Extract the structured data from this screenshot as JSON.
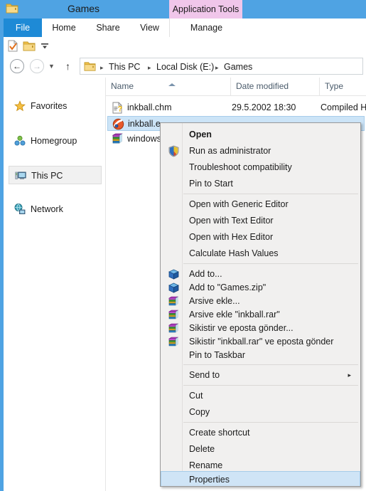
{
  "window": {
    "title": "Games",
    "folder_icon": "folder-icon",
    "contextual_tab": "Application Tools"
  },
  "ribbon": {
    "tabs": [
      {
        "label": "File",
        "name": "tab-file",
        "active": true
      },
      {
        "label": "Home",
        "name": "tab-home",
        "active": false
      },
      {
        "label": "Share",
        "name": "tab-share",
        "active": false
      },
      {
        "label": "View",
        "name": "tab-view",
        "active": false
      },
      {
        "label": "Manage",
        "name": "tab-manage",
        "active": false
      }
    ]
  },
  "quick_access": {
    "icons": [
      "properties-icon",
      "new-folder-icon",
      "customize-dropdown-icon"
    ]
  },
  "address_bar": {
    "back_icon": "back-arrow-icon",
    "forward_icon": "forward-arrow-icon",
    "recent_icon": "recent-locations-chevron-icon",
    "up_icon": "up-arrow-icon",
    "folder_icon": "folder-icon",
    "breadcrumbs": [
      "This PC",
      "Local Disk (E:)",
      "Games"
    ],
    "separator": "▸"
  },
  "sidebar": {
    "items": [
      {
        "label": "Favorites",
        "icon": "star-icon",
        "selected": false
      },
      {
        "label": "Homegroup",
        "icon": "homegroup-icon",
        "selected": false
      },
      {
        "label": "This PC",
        "icon": "computer-icon",
        "selected": true
      },
      {
        "label": "Network",
        "icon": "network-icon",
        "selected": false
      }
    ]
  },
  "file_list": {
    "columns": [
      "Name",
      "Date modified",
      "Type"
    ],
    "sort_column": "Name",
    "sort_direction": "ascending",
    "rows": [
      {
        "name": "inkball.chm",
        "date": "29.5.2002 18:30",
        "type": "Compiled HT",
        "icon": "chm-help-icon",
        "selected": false
      },
      {
        "name": "inkball.e",
        "date": "",
        "type": "",
        "icon": "inkball-exe-icon",
        "selected": true
      },
      {
        "name": "windows",
        "date": "",
        "type": "",
        "icon": "winrar-archive-icon",
        "selected": false
      }
    ]
  },
  "context_menu": {
    "items": [
      {
        "label": "Open",
        "icon": null,
        "bold": true,
        "selected": false,
        "submenu": false
      },
      {
        "label": "Run as administrator",
        "icon": "shield-icon",
        "bold": false,
        "selected": false,
        "submenu": false
      },
      {
        "label": "Troubleshoot compatibility",
        "icon": null,
        "bold": false,
        "selected": false,
        "submenu": false
      },
      {
        "label": "Pin to Start",
        "icon": null,
        "bold": false,
        "selected": false,
        "submenu": false
      },
      {
        "label": "Open with Generic Editor",
        "icon": null,
        "bold": false,
        "selected": false,
        "submenu": false
      },
      {
        "label": "Open with Text Editor",
        "icon": null,
        "bold": false,
        "selected": false,
        "submenu": false
      },
      {
        "label": "Open with Hex Editor",
        "icon": null,
        "bold": false,
        "selected": false,
        "submenu": false
      },
      {
        "label": "Calculate Hash Values",
        "icon": null,
        "bold": false,
        "selected": false,
        "submenu": false
      },
      {
        "label": "Add to...",
        "icon": "7zip-icon",
        "bold": false,
        "selected": false,
        "submenu": false
      },
      {
        "label": "Add to  \"Games.zip\"",
        "icon": "7zip-icon",
        "bold": false,
        "selected": false,
        "submenu": false
      },
      {
        "label": "Arsive ekle...",
        "icon": "winrar-icon",
        "bold": false,
        "selected": false,
        "submenu": false
      },
      {
        "label": "Arsive ekle \"inkball.rar\"",
        "icon": "winrar-icon",
        "bold": false,
        "selected": false,
        "submenu": false
      },
      {
        "label": "Sikistir ve eposta gönder...",
        "icon": "winrar-icon",
        "bold": false,
        "selected": false,
        "submenu": false
      },
      {
        "label": "Sikistir \"inkball.rar\" ve eposta gönder",
        "icon": "winrar-icon",
        "bold": false,
        "selected": false,
        "submenu": false
      },
      {
        "label": "Pin to Taskbar",
        "icon": null,
        "bold": false,
        "selected": false,
        "submenu": false
      },
      {
        "label": "Send to",
        "icon": null,
        "bold": false,
        "selected": false,
        "submenu": true
      },
      {
        "label": "Cut",
        "icon": null,
        "bold": false,
        "selected": false,
        "submenu": false
      },
      {
        "label": "Copy",
        "icon": null,
        "bold": false,
        "selected": false,
        "submenu": false
      },
      {
        "label": "Create shortcut",
        "icon": null,
        "bold": false,
        "selected": false,
        "submenu": false
      },
      {
        "label": "Delete",
        "icon": null,
        "bold": false,
        "selected": false,
        "submenu": false
      },
      {
        "label": "Rename",
        "icon": null,
        "bold": false,
        "selected": false,
        "submenu": false
      },
      {
        "label": "Properties",
        "icon": null,
        "bold": false,
        "selected": true,
        "submenu": false
      }
    ],
    "separator_after_indices": [
      3,
      7,
      14,
      15,
      17,
      20
    ],
    "submenu_arrow": "▸"
  },
  "colors": {
    "titlebar": "#4fa3e3",
    "file_tab": "#1e8ad6",
    "contextual_tab": "#f0c6ea",
    "selection": "#cce4f7",
    "menu_background": "#f1f0ef",
    "menu_selection": "#cfe4f6",
    "column_header_text": "#4a5b6b"
  }
}
